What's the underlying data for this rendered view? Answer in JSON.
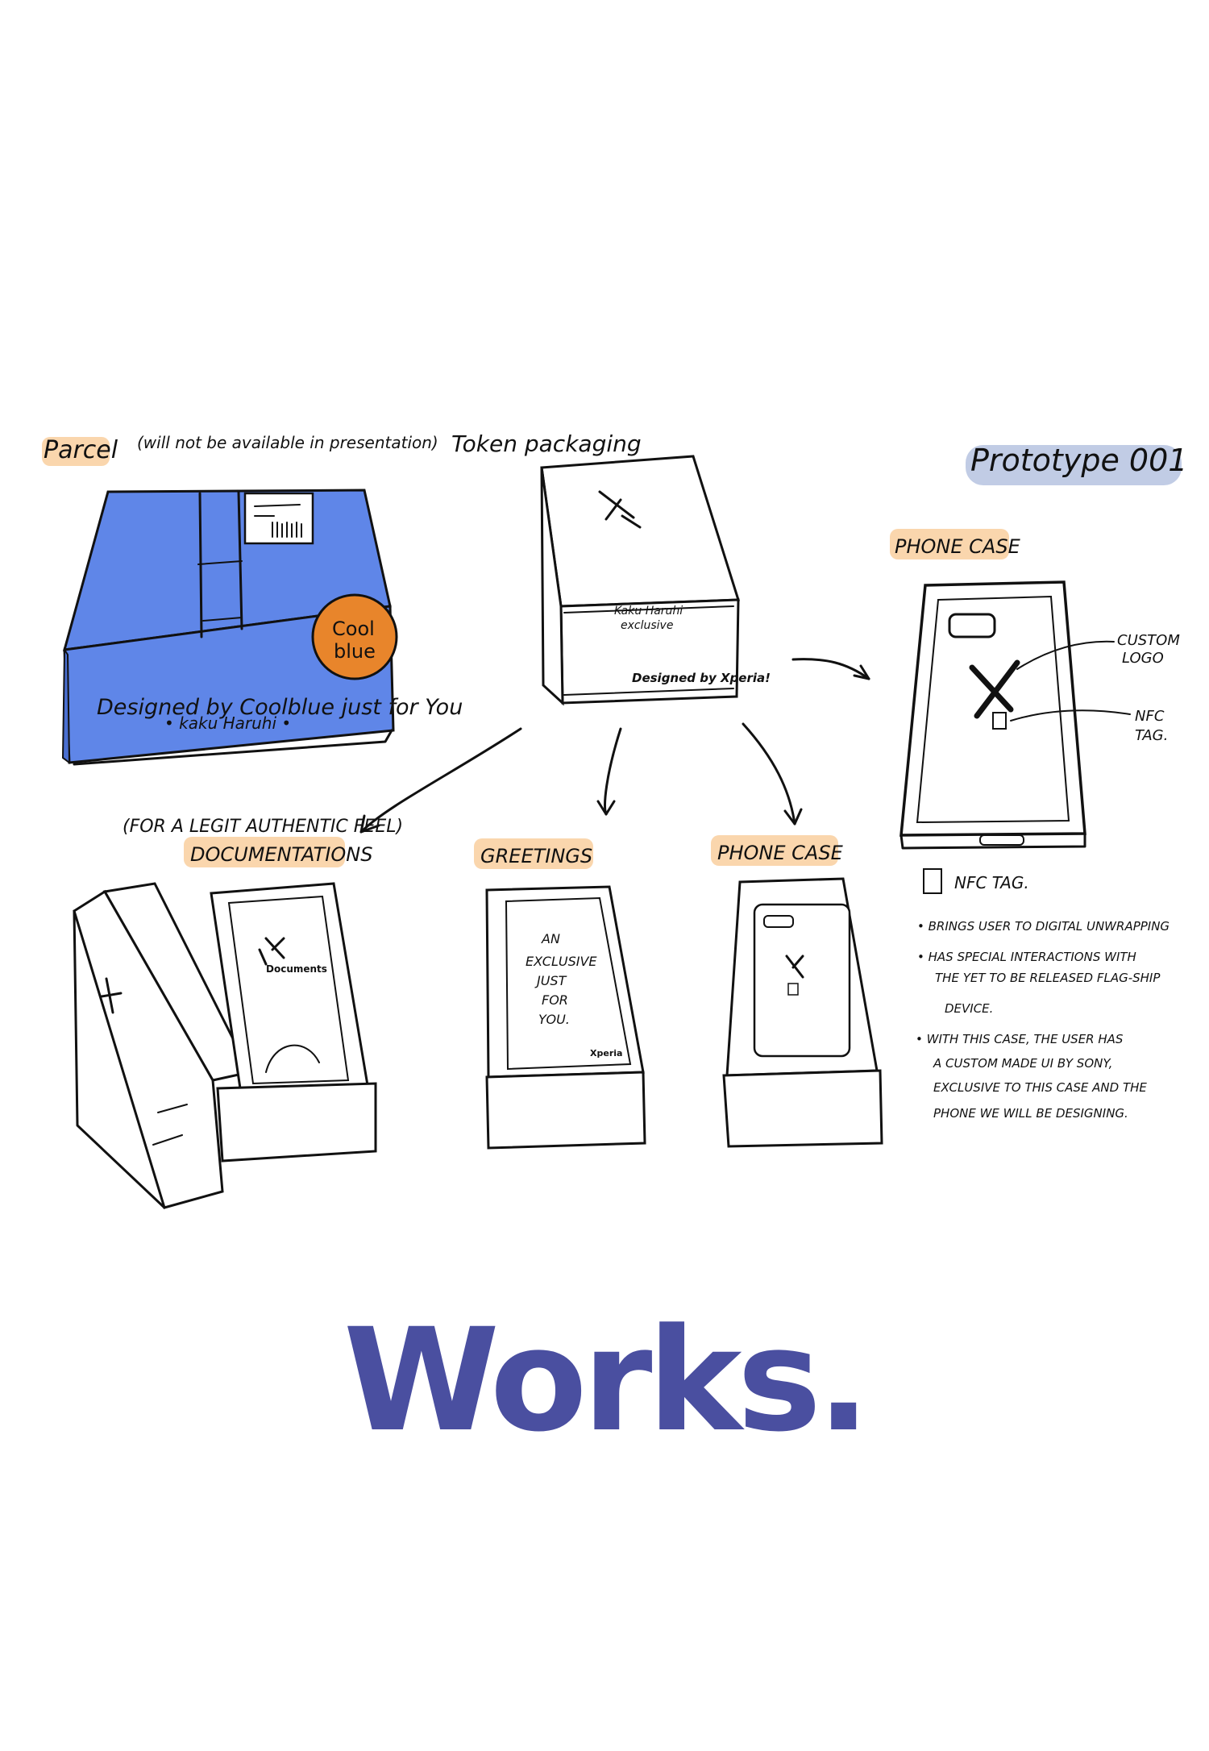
{
  "heading": "Prototype 001",
  "labels": {
    "parcel": "Parcel",
    "parcel_note": "(will not be available in presentation)",
    "token_packaging": "Token packaging",
    "legit_note": "(FOR A LEGIT AUTHENTIC FEEL)",
    "documentations": "DOCUMENTATIONS",
    "greetings": "GREETINGS",
    "phone_case_mid": "PHONE CASE",
    "phone_case_right": "PHONE CASE",
    "custom_logo_1": "CUSTOM",
    "custom_logo_2": "LOGO",
    "nfc_tag_1": "NFC",
    "nfc_tag_2": "TAG."
  },
  "parcel_box": {
    "line1": "Designed by Coolblue just for You",
    "line2": "• kaku Haruhi •",
    "sticker_1": "Cool",
    "sticker_2": "blue"
  },
  "token_box": {
    "line1": "Kaku Haruhi",
    "line2": "exclusive",
    "sign": "Designed by Xperia!"
  },
  "docs_box": {
    "caption": "Documents"
  },
  "greeting_card": {
    "lines": [
      "AN",
      "EXCLUSIVE",
      "JUST",
      "FOR",
      "YOU."
    ],
    "sign": "Xperia"
  },
  "nfc_notes": {
    "title": "NFC TAG.",
    "bullets": [
      [
        "• BRINGS USER TO DIGITAL UNWRAPPING"
      ],
      [
        "• HAS SPECIAL INTERACTIONS WITH",
        "THE YET TO BE RELEASED FLAG-SHIP",
        "DEVICE."
      ],
      [
        "• WITH THIS CASE, THE USER HAS",
        "A CUSTOM MADE UI BY SONY,",
        "EXCLUSIVE TO THIS CASE AND THE",
        "PHONE WE WILL BE DESIGNING."
      ]
    ]
  },
  "footer_title": "Works.",
  "colors": {
    "parcel_blue": "#5f86e8",
    "sticker_orange": "#e8852b",
    "highlight_orange": "#f6b46a",
    "highlight_blue": "#8ea3cf",
    "title_purple": "#4a4fa0"
  }
}
